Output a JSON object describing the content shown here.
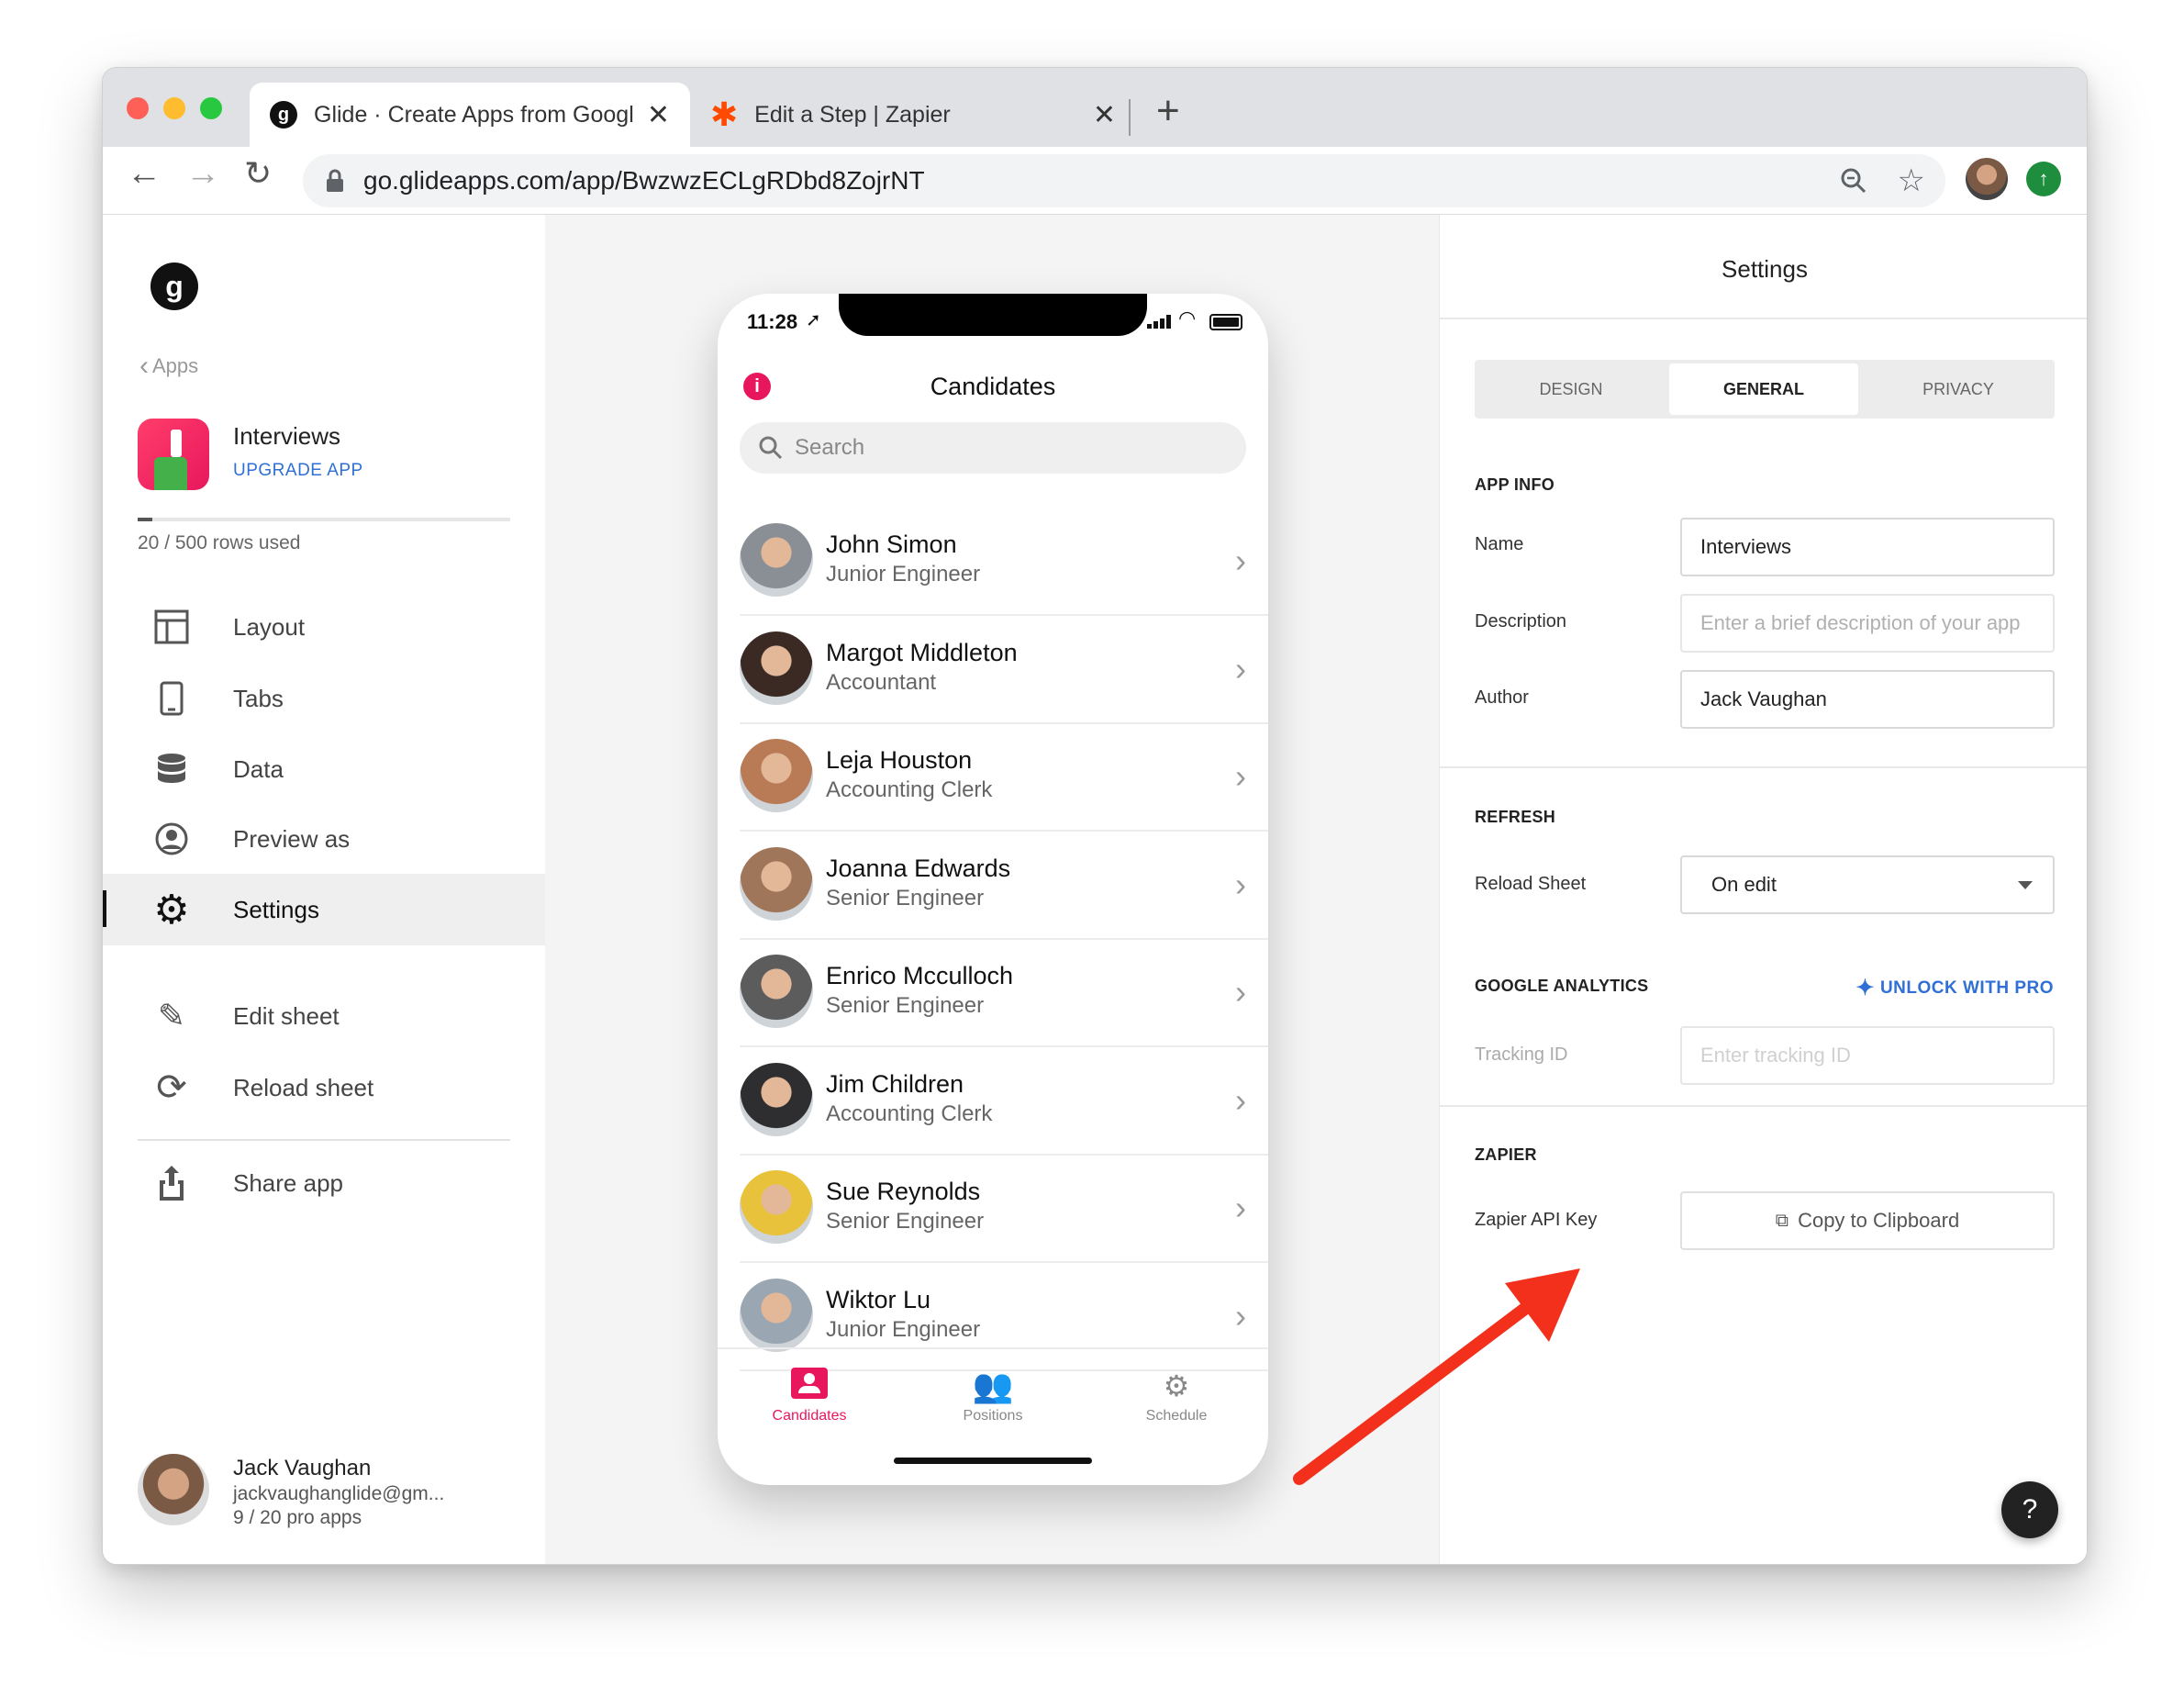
{
  "browser": {
    "tabs": [
      {
        "title": "Glide · Create Apps from Google Sheets"
      },
      {
        "title": "Edit a Step | Zapier"
      }
    ],
    "url": "go.glideapps.com/app/BwzwzECLgRDbd8ZojrNT"
  },
  "sidebar": {
    "back_label": "Apps",
    "app_name": "Interviews",
    "upgrade_label": "UPGRADE APP",
    "rows_used": "20 / 500 rows used",
    "rows_fraction": 0.04,
    "nav": [
      {
        "label": "Layout"
      },
      {
        "label": "Tabs"
      },
      {
        "label": "Data"
      },
      {
        "label": "Preview as"
      },
      {
        "label": "Settings"
      },
      {
        "label": "Edit sheet"
      },
      {
        "label": "Reload sheet"
      },
      {
        "label": "Share app"
      }
    ],
    "user": {
      "name": "Jack Vaughan",
      "email": "jackvaughanglide@gm...",
      "pro_apps": "9 / 20 pro apps"
    }
  },
  "phone": {
    "time": "11:28",
    "title": "Candidates",
    "search_placeholder": "Search",
    "contacts": [
      {
        "name": "John Simon",
        "role": "Junior Engineer",
        "color": "#8a8f96"
      },
      {
        "name": "Margot Middleton",
        "role": "Accountant",
        "color": "#3b2a24"
      },
      {
        "name": "Leja Houston",
        "role": "Accounting Clerk",
        "color": "#b97a56"
      },
      {
        "name": "Joanna Edwards",
        "role": "Senior Engineer",
        "color": "#a0765a"
      },
      {
        "name": "Enrico Mcculloch",
        "role": "Senior Engineer",
        "color": "#5c5c5c"
      },
      {
        "name": "Jim Children",
        "role": "Accounting Clerk",
        "color": "#2e2e30"
      },
      {
        "name": "Sue Reynolds",
        "role": "Senior Engineer",
        "color": "#e8c23a"
      },
      {
        "name": "Wiktor Lu",
        "role": "Junior Engineer",
        "color": "#9aa6b2"
      }
    ],
    "bottom_tabs": [
      {
        "label": "Candidates"
      },
      {
        "label": "Positions"
      },
      {
        "label": "Schedule"
      }
    ]
  },
  "settings": {
    "title": "Settings",
    "tabs": [
      {
        "label": "DESIGN"
      },
      {
        "label": "GENERAL"
      },
      {
        "label": "PRIVACY"
      }
    ],
    "app_info_heading": "APP INFO",
    "name_label": "Name",
    "name_value": "Interviews",
    "description_label": "Description",
    "description_placeholder": "Enter a brief description of your app",
    "author_label": "Author",
    "author_value": "Jack Vaughan",
    "refresh_heading": "REFRESH",
    "reload_label": "Reload Sheet",
    "reload_value": "On edit",
    "ga_heading": "GOOGLE ANALYTICS",
    "unlock_label": "UNLOCK WITH PRO",
    "tracking_label": "Tracking ID",
    "tracking_placeholder": "Enter tracking ID",
    "zapier_heading": "ZAPIER",
    "zapier_label": "Zapier API Key",
    "copy_label": "Copy to Clipboard",
    "help_label": "?"
  },
  "colors": {
    "accent_pink": "#e8175d",
    "upgrade_blue": "#2f6fd6",
    "unlock_blue": "#2f6fd6",
    "arrow_red": "#f2301b"
  }
}
